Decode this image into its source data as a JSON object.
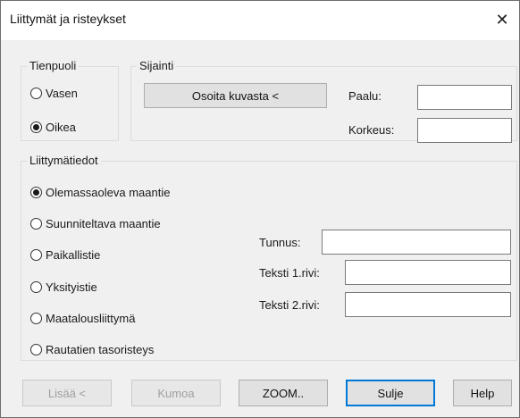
{
  "window": {
    "title": "Liittymät ja risteykset",
    "close_glyph": "✕"
  },
  "tienpuoli": {
    "legend": "Tienpuoli",
    "options": [
      {
        "label": "Vasen",
        "checked": false
      },
      {
        "label": "Oikea",
        "checked": true
      }
    ]
  },
  "sijainti": {
    "legend": "Sijainti",
    "pick_button": "Osoita kuvasta <",
    "paalu_label": "Paalu:",
    "paalu_value": "",
    "korkeus_label": "Korkeus:",
    "korkeus_value": ""
  },
  "liittymatiedot": {
    "legend": "Liittymätiedot",
    "options": [
      {
        "label": "Olemassaoleva maantie",
        "checked": true
      },
      {
        "label": "Suunniteltava maantie",
        "checked": false
      },
      {
        "label": "Paikallistie",
        "checked": false
      },
      {
        "label": "Yksityistie",
        "checked": false
      },
      {
        "label": "Maatalousliittymä",
        "checked": false
      },
      {
        "label": "Rautatien tasoristeys",
        "checked": false
      }
    ],
    "tunnus_label": "Tunnus:",
    "tunnus_value": "",
    "teksti1_label": "Teksti 1.rivi:",
    "teksti1_value": "",
    "teksti2_label": "Teksti 2.rivi:",
    "teksti2_value": ""
  },
  "buttons": {
    "lisaa": "Lisää <",
    "kumoa": "Kumoa",
    "zoom": "ZOOM..",
    "sulje": "Sulje",
    "help": "Help"
  }
}
